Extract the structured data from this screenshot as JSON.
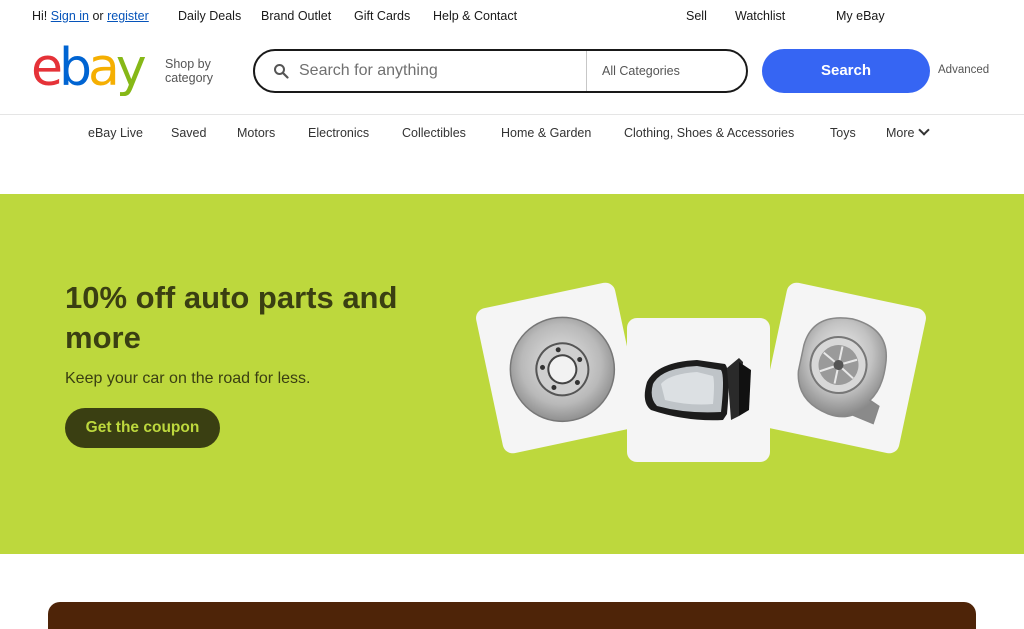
{
  "topbar": {
    "greeting": "Hi!",
    "sign_in": "Sign in",
    "or": "or",
    "register": "register",
    "links": [
      "Daily Deals",
      "Brand Outlet",
      "Gift Cards",
      "Help & Contact"
    ],
    "sell": "Sell",
    "watchlist": "Watchlist",
    "my_ebay": "My eBay"
  },
  "header": {
    "logo_letters": [
      "e",
      "b",
      "a",
      "y"
    ],
    "logo_colors": [
      "#e53238",
      "#0064d2",
      "#f5af02",
      "#86b817"
    ],
    "shop_by_category": "Shop by category",
    "search": {
      "placeholder": "Search for anything",
      "category": "All Categories",
      "button": "Search",
      "advanced": "Advanced"
    }
  },
  "nav": {
    "items": [
      "eBay Live",
      "Saved",
      "Motors",
      "Electronics",
      "Collectibles",
      "Home & Garden",
      "Clothing, Shoes & Accessories",
      "Toys",
      "More"
    ]
  },
  "hero": {
    "title": "10% off auto parts and more",
    "subtitle": "Keep your car on the road for less.",
    "cta": "Get the coupon",
    "background": "#bdd83d",
    "text_color": "#3a3f12"
  },
  "colors": {
    "search_button": "#3665f3",
    "link": "#0654ba",
    "bottom_band": "#4e2408"
  }
}
